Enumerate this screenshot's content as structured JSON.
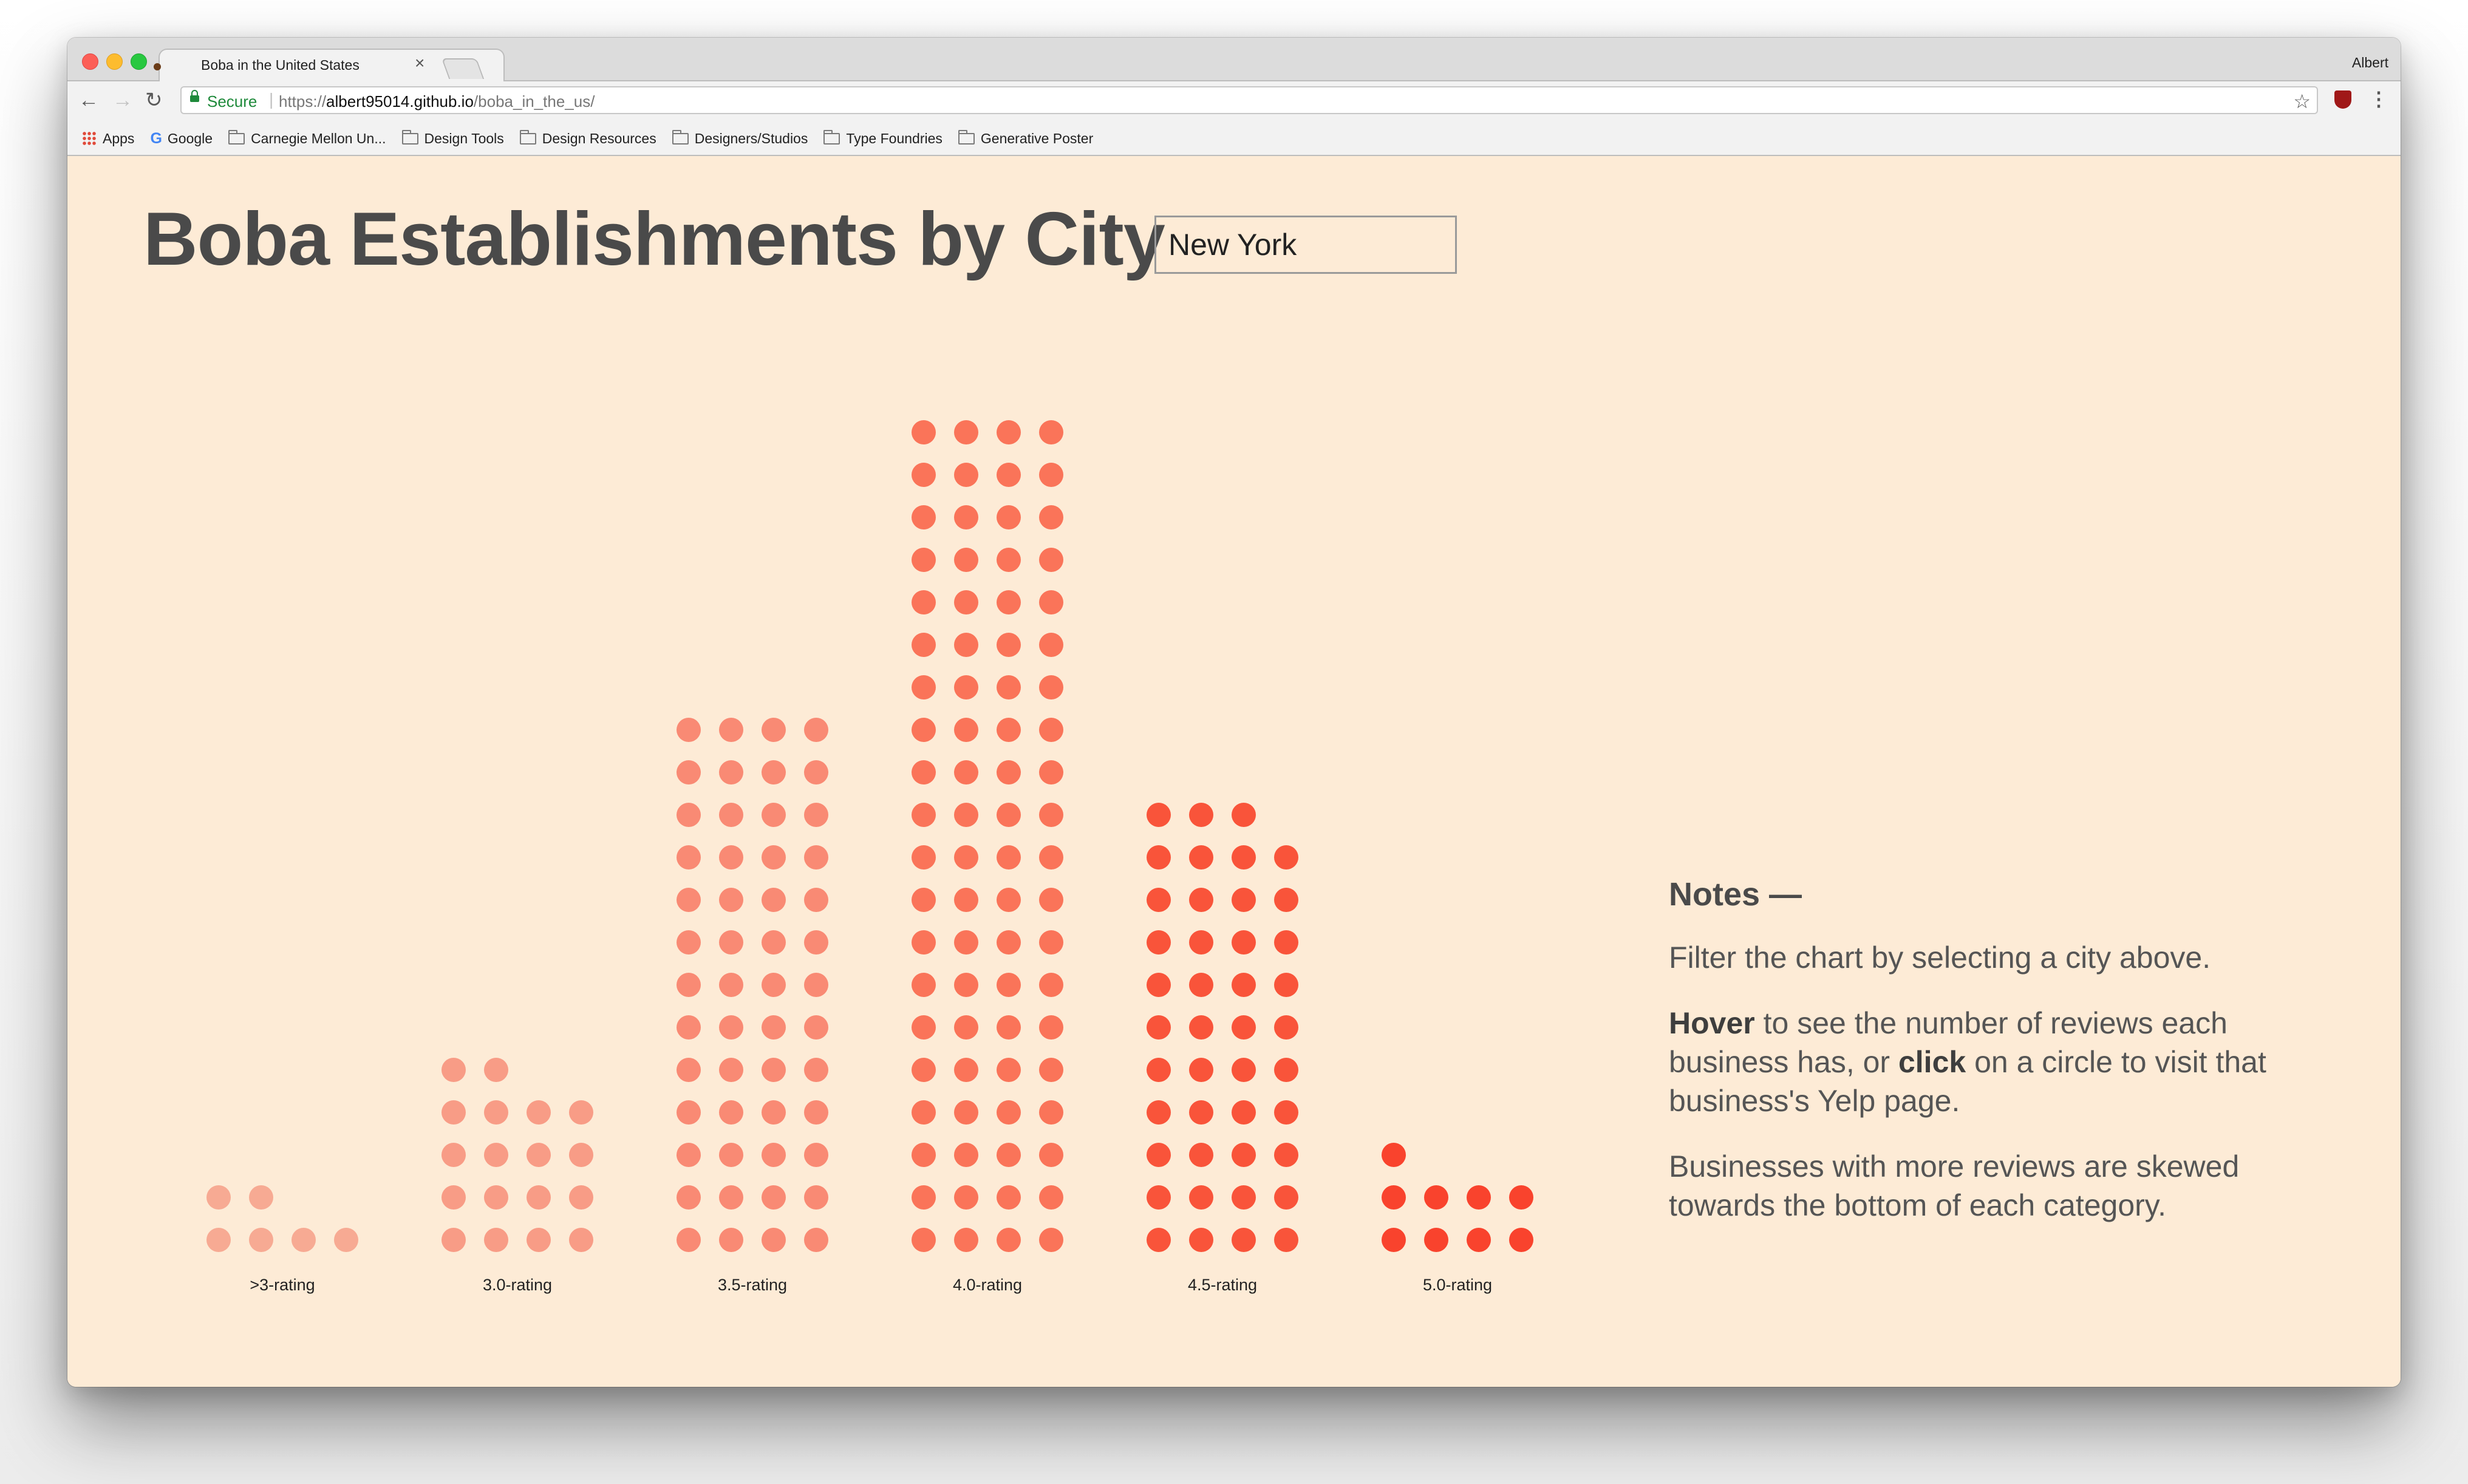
{
  "browser": {
    "tab_title": "Boba in the United States",
    "tab_close": "×",
    "profile_name": "Albert",
    "secure_label": "Secure",
    "url_scheme": "https://",
    "url_host": "albert95014.github.io",
    "url_path": "/boba_in_the_us/",
    "nav_back": "←",
    "nav_forward": "→",
    "nav_reload": "↻",
    "star": "☆",
    "menu": "⋮",
    "bookmarks": [
      {
        "label": "Apps",
        "icon": "apps-grid-icon"
      },
      {
        "label": "Google",
        "icon": "google-icon"
      },
      {
        "label": "Carnegie Mellon Un...",
        "icon": "folder-icon"
      },
      {
        "label": "Design Tools",
        "icon": "folder-icon"
      },
      {
        "label": "Design Resources",
        "icon": "folder-icon"
      },
      {
        "label": "Designers/Studios",
        "icon": "folder-icon"
      },
      {
        "label": "Type Foundries",
        "icon": "folder-icon"
      },
      {
        "label": "Generative Poster",
        "icon": "folder-icon"
      }
    ]
  },
  "page": {
    "title": "Boba Establishments by City",
    "city_value": "New York",
    "notes": {
      "heading": "Notes —",
      "p1": "Filter the chart by selecting a city above.",
      "p2_bold1": "Hover",
      "p2_text1": " to see the number of reviews each business has, or ",
      "p2_bold2": "click",
      "p2_text2": " on a circle to visit that business's Yelp page.",
      "p3": "Businesses with more reviews are skewed towards the bottom of each category."
    }
  },
  "chart_data": {
    "type": "scatter",
    "categories": [
      ">3-rating",
      "3.0-rating",
      "3.5-rating",
      "4.0-rating",
      "4.5-rating",
      "5.0-rating"
    ],
    "values": [
      6,
      18,
      52,
      80,
      43,
      9
    ],
    "columns_per_row": 4,
    "colors": [
      "#f7aa93",
      "#f89c86",
      "#f98a74",
      "#fa7459",
      "#f9543a",
      "#f9432d"
    ],
    "title": "",
    "xlabel": "",
    "ylabel": ""
  }
}
